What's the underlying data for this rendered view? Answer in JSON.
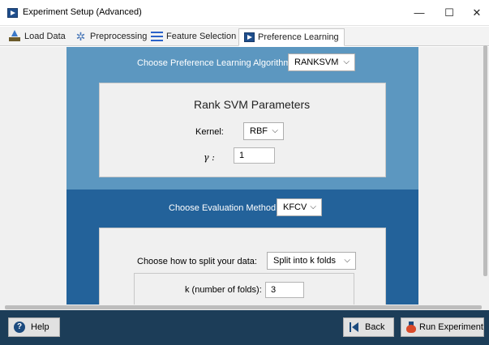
{
  "window": {
    "title": "Experiment Setup (Advanced)",
    "minimize_glyph": "—",
    "maximize_glyph": "☐",
    "close_glyph": "✕"
  },
  "tabs": [
    {
      "label": "Load Data",
      "icon": "upload-icon",
      "active": false
    },
    {
      "label": "Preprocessing",
      "icon": "preprocessing-icon",
      "active": false
    },
    {
      "label": "Feature Selection",
      "icon": "list-icon",
      "active": false
    },
    {
      "label": "Preference Learning",
      "icon": "app-play-icon",
      "active": true
    }
  ],
  "algorithm": {
    "label": "Choose Preference Learning Algorithm",
    "selected": "RANKSVM"
  },
  "ranksvm": {
    "title": "Rank SVM Parameters",
    "kernel_label": "Kernel:",
    "kernel_value": "RBF",
    "gamma_label": "γ :",
    "gamma_value": "1"
  },
  "evaluation": {
    "label": "Choose Evaluation Method",
    "selected": "KFCV",
    "split_label": "Choose how to split your data:",
    "split_value": "Split into k folds",
    "k_label": "k (number of folds):",
    "k_value": "3"
  },
  "footer": {
    "help_label": "Help",
    "back_label": "Back",
    "run_label": "Run Experiment"
  },
  "colors": {
    "section_top": "#5c97c0",
    "section_bottom": "#23629a",
    "footer": "#1c3d58"
  }
}
